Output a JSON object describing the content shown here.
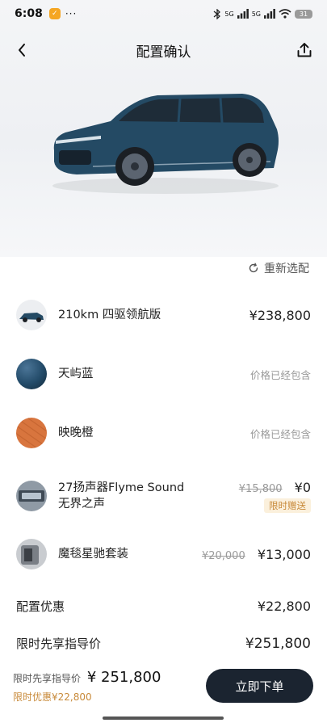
{
  "status_bar": {
    "time": "6:08",
    "dots": "···",
    "network_1": "5G",
    "network_2": "5G",
    "battery": "31"
  },
  "nav": {
    "title": "配置确认"
  },
  "reselect": {
    "label": "重新选配"
  },
  "items": [
    {
      "name": "210km 四驱领航版",
      "price": "¥238,800"
    },
    {
      "name": "天屿蓝",
      "status": "价格已经包含",
      "color": "#234b69"
    },
    {
      "name": "映晚橙",
      "status": "价格已经包含",
      "color": "#d8753e"
    },
    {
      "name_line1": "27扬声器Flyme Sound",
      "name_line2": "无界之声",
      "original_price": "¥15,800",
      "price": "¥0",
      "badge": "限时赠送"
    },
    {
      "name": "魔毯星驰套装",
      "original_price": "¥20,000",
      "price": "¥13,000"
    }
  ],
  "summary": {
    "discount_label": "配置优惠",
    "discount_value": "¥22,800",
    "total_label": "限时先享指导价",
    "total_value": "¥251,800"
  },
  "footer": {
    "price_label": "限时先享指导价",
    "price_value": "¥ 251,800",
    "discount_text": "限时优惠¥22,800",
    "order_button": "立即下单"
  },
  "colors": {
    "car_body": "#244a64",
    "accent_gold": "#c88a3a",
    "button_dark": "#1b2430"
  }
}
